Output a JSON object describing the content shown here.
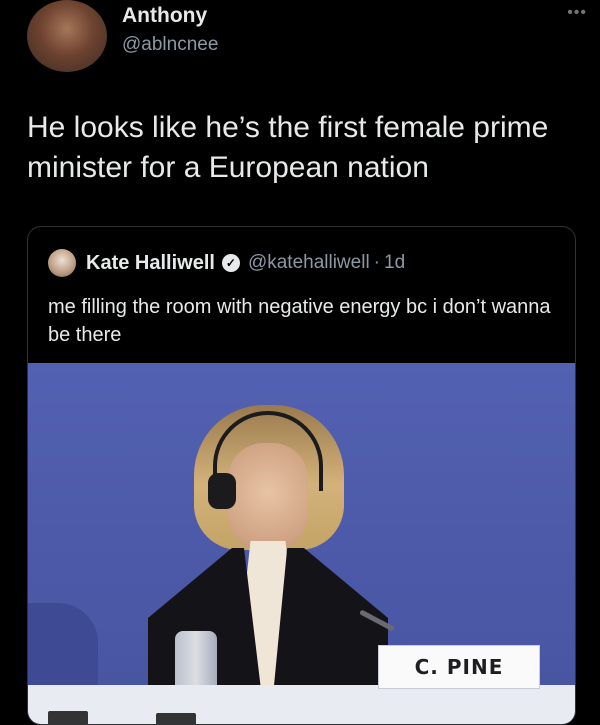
{
  "tweet": {
    "author_name": "Anthony",
    "author_handle": "@ablncnee",
    "text": "He looks like he’s the first female prime minister for a European nation"
  },
  "quote": {
    "author_name": "Kate Halliwell",
    "verified_icon": "verified-badge-icon",
    "author_handle": "@katehalliwell",
    "separator": "·",
    "time": "1d",
    "text": "me filling the room with negative energy bc i don’t wanna be there",
    "photo": {
      "nameplate": "C. PINE"
    }
  },
  "icons": {
    "more": "more-options-icon"
  }
}
